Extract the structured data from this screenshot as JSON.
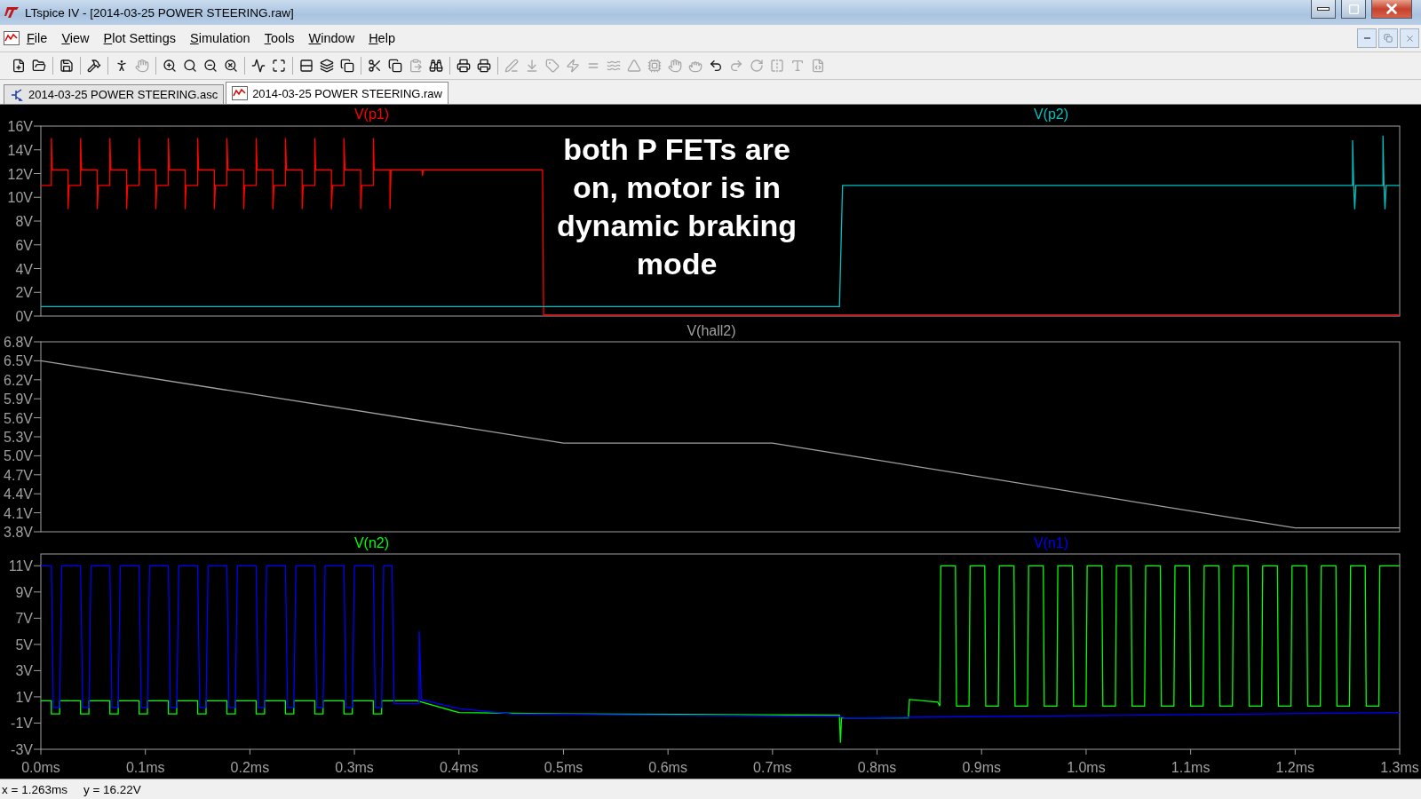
{
  "window": {
    "title": "LTspice IV - [2014-03-25 POWER STEERING.raw]"
  },
  "menu": [
    {
      "label": "File"
    },
    {
      "label": "View"
    },
    {
      "label": "Plot Settings"
    },
    {
      "label": "Simulation"
    },
    {
      "label": "Tools"
    },
    {
      "label": "Window"
    },
    {
      "label": "Help"
    }
  ],
  "toolbar": [
    {
      "kind": "button",
      "disabled": false
    },
    {
      "kind": "button",
      "disabled": false
    },
    {
      "kind": "separator"
    },
    {
      "kind": "button",
      "disabled": false
    },
    {
      "kind": "separator"
    },
    {
      "kind": "button",
      "disabled": false
    },
    {
      "kind": "separator"
    },
    {
      "kind": "button",
      "disabled": false
    },
    {
      "kind": "button",
      "disabled": true
    },
    {
      "kind": "separator"
    },
    {
      "kind": "button",
      "disabled": false
    },
    {
      "kind": "button",
      "disabled": false
    },
    {
      "kind": "button",
      "disabled": false
    },
    {
      "kind": "button",
      "disabled": false
    },
    {
      "kind": "separator"
    },
    {
      "kind": "button",
      "disabled": false
    },
    {
      "kind": "button",
      "disabled": false
    },
    {
      "kind": "separator"
    },
    {
      "kind": "button",
      "disabled": false
    },
    {
      "kind": "button",
      "disabled": false
    },
    {
      "kind": "button",
      "disabled": false
    },
    {
      "kind": "separator"
    },
    {
      "kind": "button",
      "disabled": false
    },
    {
      "kind": "button",
      "disabled": false
    },
    {
      "kind": "button",
      "disabled": true
    },
    {
      "kind": "button",
      "disabled": false
    },
    {
      "kind": "separator"
    },
    {
      "kind": "button",
      "disabled": false
    },
    {
      "kind": "button",
      "disabled": false
    },
    {
      "kind": "separator"
    },
    {
      "kind": "button",
      "disabled": true
    },
    {
      "kind": "button",
      "disabled": true
    },
    {
      "kind": "button",
      "disabled": true
    },
    {
      "kind": "button",
      "disabled": true
    },
    {
      "kind": "button",
      "disabled": true
    },
    {
      "kind": "button",
      "disabled": true
    },
    {
      "kind": "button",
      "disabled": true
    },
    {
      "kind": "button",
      "disabled": true
    },
    {
      "kind": "button",
      "disabled": true
    },
    {
      "kind": "button",
      "disabled": true
    },
    {
      "kind": "button",
      "disabled": false
    },
    {
      "kind": "button",
      "disabled": true
    },
    {
      "kind": "button",
      "disabled": true
    },
    {
      "kind": "button",
      "disabled": true
    },
    {
      "kind": "button",
      "disabled": true
    },
    {
      "kind": "button",
      "disabled": true
    }
  ],
  "tabs": [
    {
      "label": "2014-03-25 POWER STEERING.asc",
      "kind": "schematic",
      "selected": false
    },
    {
      "label": "2014-03-25 POWER STEERING.raw",
      "kind": "waveform",
      "selected": true
    }
  ],
  "panes": [
    {
      "chart_data": {
        "type": "line",
        "xlim": [
          0,
          1.3
        ],
        "ylim": [
          0,
          16
        ],
        "yticks": [
          {
            "value": 16,
            "label": "16V"
          },
          {
            "value": 14,
            "label": "14V"
          },
          {
            "value": 12,
            "label": "12V"
          },
          {
            "value": 10,
            "label": "10V"
          },
          {
            "value": 8,
            "label": "8V"
          },
          {
            "value": 6,
            "label": "6V"
          },
          {
            "value": 4,
            "label": "4V"
          },
          {
            "value": 2,
            "label": "2V"
          },
          {
            "value": 0,
            "label": "0V"
          }
        ],
        "series": [
          {
            "name": "V(p1)",
            "color": "#ff0000",
            "x": [
              0,
              0.01,
              0.01,
              0.011,
              0.026,
              0.026,
              0.027,
              0.038,
              0.038,
              0.039,
              0.054,
              0.054,
              0.055,
              0.066,
              0.066,
              0.067,
              0.082,
              0.082,
              0.083,
              0.094,
              0.094,
              0.095,
              0.11,
              0.11,
              0.111,
              0.122,
              0.122,
              0.123,
              0.138,
              0.138,
              0.139,
              0.15,
              0.15,
              0.151,
              0.166,
              0.166,
              0.167,
              0.178,
              0.178,
              0.179,
              0.194,
              0.194,
              0.195,
              0.206,
              0.206,
              0.207,
              0.222,
              0.222,
              0.223,
              0.234,
              0.234,
              0.235,
              0.25,
              0.25,
              0.251,
              0.262,
              0.262,
              0.263,
              0.278,
              0.278,
              0.279,
              0.29,
              0.29,
              0.291,
              0.306,
              0.306,
              0.307,
              0.318,
              0.318,
              0.319,
              0.334,
              0.334,
              0.335,
              0.365,
              0.365,
              0.366,
              0.48,
              0.481,
              1.3
            ],
            "values": [
              11,
              11,
              15,
              12.3,
              12.3,
              9,
              11,
              11,
              15,
              12.3,
              12.3,
              9,
              11,
              11,
              15,
              12.3,
              12.3,
              9,
              11,
              11,
              15,
              12.3,
              12.3,
              9,
              11,
              11,
              15,
              12.3,
              12.3,
              9,
              11,
              11,
              15,
              12.3,
              12.3,
              9,
              11,
              11,
              15,
              12.3,
              12.3,
              9,
              11,
              11,
              15,
              12.3,
              12.3,
              9,
              11,
              11,
              15,
              12.3,
              12.3,
              9,
              11,
              11,
              15,
              12.3,
              12.3,
              9,
              11,
              11,
              15,
              12.3,
              12.3,
              9,
              11,
              11,
              15,
              12.3,
              12.3,
              9,
              12.3,
              12.3,
              11.8,
              12.3,
              12.3,
              0.1,
              0.1
            ]
          },
          {
            "name": "V(p2)",
            "color": "#00c0c0",
            "x": [
              0,
              0.764,
              0.767,
              1.255,
              1.255,
              1.256,
              1.257,
              1.258,
              1.284,
              1.284,
              1.285,
              1.286,
              1.287,
              1.3
            ],
            "values": [
              0.8,
              0.8,
              11,
              11,
              14.8,
              11,
              9,
              11,
              11,
              15.2,
              11,
              9,
              11,
              11
            ]
          }
        ],
        "annotations": [
          "both P FETs are",
          "on, motor is in",
          "dynamic braking",
          "mode"
        ]
      }
    },
    {
      "chart_data": {
        "type": "line",
        "xlim": [
          0,
          1.3
        ],
        "ylim": [
          3.8,
          6.8
        ],
        "yticks": [
          {
            "value": 6.8,
            "label": "6.8V"
          },
          {
            "value": 6.5,
            "label": "6.5V"
          },
          {
            "value": 6.2,
            "label": "6.2V"
          },
          {
            "value": 5.9,
            "label": "5.9V"
          },
          {
            "value": 5.6,
            "label": "5.6V"
          },
          {
            "value": 5.3,
            "label": "5.3V"
          },
          {
            "value": 5.0,
            "label": "5.0V"
          },
          {
            "value": 4.7,
            "label": "4.7V"
          },
          {
            "value": 4.4,
            "label": "4.4V"
          },
          {
            "value": 4.1,
            "label": "4.1V"
          },
          {
            "value": 3.8,
            "label": "3.8V"
          }
        ],
        "series": [
          {
            "name": "V(hall2)",
            "color": "#a0a0a0",
            "x": [
              0,
              0.5,
              0.7,
              1.2,
              1.3
            ],
            "values": [
              6.5,
              5.2,
              5.2,
              3.86,
              3.86
            ]
          }
        ]
      }
    },
    {
      "chart_data": {
        "type": "line",
        "xlim": [
          0,
          1.3
        ],
        "ylim": [
          -3,
          11.9
        ],
        "yticks": [
          {
            "value": 11,
            "label": "11V"
          },
          {
            "value": 9,
            "label": "9V"
          },
          {
            "value": 7,
            "label": "7V"
          },
          {
            "value": 5,
            "label": "5V"
          },
          {
            "value": 3,
            "label": "3V"
          },
          {
            "value": 1,
            "label": "1V"
          },
          {
            "value": -1,
            "label": "-1V"
          },
          {
            "value": -3,
            "label": "-3V"
          }
        ],
        "xticks": [
          {
            "value": 0,
            "label": "0.0ms"
          },
          {
            "value": 0.1,
            "label": "0.1ms"
          },
          {
            "value": 0.2,
            "label": "0.2ms"
          },
          {
            "value": 0.3,
            "label": "0.3ms"
          },
          {
            "value": 0.4,
            "label": "0.4ms"
          },
          {
            "value": 0.5,
            "label": "0.5ms"
          },
          {
            "value": 0.6,
            "label": "0.6ms"
          },
          {
            "value": 0.7,
            "label": "0.7ms"
          },
          {
            "value": 0.8,
            "label": "0.8ms"
          },
          {
            "value": 0.9,
            "label": "0.9ms"
          },
          {
            "value": 1.0,
            "label": "1.0ms"
          },
          {
            "value": 1.1,
            "label": "1.1ms"
          },
          {
            "value": 1.2,
            "label": "1.2ms"
          },
          {
            "value": 1.3,
            "label": "1.3ms"
          }
        ],
        "series": [
          {
            "name": "V(n2)",
            "color": "#00ff00",
            "x": [
              0,
              0.01,
              0.01,
              0.018,
              0.018,
              0.038,
              0.038,
              0.046,
              0.046,
              0.066,
              0.066,
              0.074,
              0.074,
              0.094,
              0.094,
              0.102,
              0.102,
              0.122,
              0.122,
              0.13,
              0.13,
              0.15,
              0.15,
              0.158,
              0.158,
              0.178,
              0.178,
              0.186,
              0.186,
              0.206,
              0.206,
              0.214,
              0.214,
              0.234,
              0.234,
              0.242,
              0.242,
              0.262,
              0.262,
              0.27,
              0.27,
              0.29,
              0.29,
              0.298,
              0.298,
              0.318,
              0.318,
              0.326,
              0.326,
              0.36,
              0.4,
              0.5,
              0.764,
              0.765,
              0.766,
              0.83,
              0.831,
              0.858,
              0.86,
              0.861,
              0.875,
              0.876,
              0.888,
              0.889,
              0.903,
              0.904,
              0.916,
              0.917,
              0.931,
              0.932,
              0.944,
              0.945,
              0.959,
              0.96,
              0.972,
              0.973,
              0.987,
              0.988,
              1.0,
              1.001,
              1.015,
              1.016,
              1.028,
              1.029,
              1.043,
              1.044,
              1.056,
              1.057,
              1.071,
              1.072,
              1.084,
              1.085,
              1.099,
              1.1,
              1.112,
              1.113,
              1.127,
              1.128,
              1.14,
              1.141,
              1.155,
              1.156,
              1.168,
              1.169,
              1.183,
              1.184,
              1.196,
              1.197,
              1.211,
              1.212,
              1.224,
              1.225,
              1.239,
              1.24,
              1.252,
              1.253,
              1.267,
              1.268,
              1.28,
              1.281,
              1.3
            ],
            "values": [
              0.7,
              0.7,
              -0.3,
              -0.3,
              0.7,
              0.7,
              -0.3,
              -0.3,
              0.7,
              0.7,
              -0.3,
              -0.3,
              0.7,
              0.7,
              -0.3,
              -0.3,
              0.7,
              0.7,
              -0.3,
              -0.3,
              0.7,
              0.7,
              -0.3,
              -0.3,
              0.7,
              0.7,
              -0.3,
              -0.3,
              0.7,
              0.7,
              -0.3,
              -0.3,
              0.7,
              0.7,
              -0.3,
              -0.3,
              0.7,
              0.7,
              -0.3,
              -0.3,
              0.7,
              0.7,
              -0.3,
              -0.3,
              0.7,
              0.7,
              -0.3,
              -0.3,
              0.7,
              0.7,
              -0.2,
              -0.3,
              -0.4,
              -2.5,
              -0.6,
              -0.6,
              0.8,
              0.6,
              0.3,
              11,
              11,
              0.3,
              0.3,
              11,
              11,
              0.3,
              0.3,
              11,
              11,
              0.3,
              0.3,
              11,
              11,
              0.3,
              0.3,
              11,
              11,
              0.3,
              0.3,
              11,
              11,
              0.3,
              0.3,
              11,
              11,
              0.3,
              0.3,
              11,
              11,
              0.3,
              0.3,
              11,
              11,
              0.3,
              0.3,
              11,
              11,
              0.3,
              0.3,
              11,
              11,
              0.3,
              0.3,
              11,
              11,
              0.3,
              0.3,
              11,
              11,
              0.3,
              0.3,
              11,
              11,
              0.3,
              0.3,
              11,
              11,
              0.3,
              0.3,
              11,
              11
            ]
          },
          {
            "name": "V(n1)",
            "color": "#0000ff",
            "x": [
              0,
              0.01,
              0.012,
              0.018,
              0.02,
              0.038,
              0.04,
              0.046,
              0.048,
              0.066,
              0.068,
              0.074,
              0.076,
              0.094,
              0.096,
              0.102,
              0.104,
              0.122,
              0.124,
              0.13,
              0.132,
              0.15,
              0.152,
              0.158,
              0.16,
              0.178,
              0.18,
              0.186,
              0.188,
              0.206,
              0.208,
              0.214,
              0.216,
              0.234,
              0.236,
              0.242,
              0.244,
              0.262,
              0.264,
              0.27,
              0.272,
              0.29,
              0.292,
              0.298,
              0.3,
              0.318,
              0.32,
              0.326,
              0.328,
              0.336,
              0.338,
              0.362,
              0.362,
              0.364,
              0.4,
              0.45,
              0.764,
              0.77,
              1.3
            ],
            "values": [
              11,
              11,
              0.2,
              0.2,
              11,
              11,
              0.2,
              0.2,
              11,
              11,
              0.2,
              0.2,
              11,
              11,
              0.2,
              0.2,
              11,
              11,
              0.2,
              0.2,
              11,
              11,
              0.2,
              0.2,
              11,
              11,
              0.2,
              0.2,
              11,
              11,
              0.2,
              0.2,
              11,
              11,
              0.2,
              0.2,
              11,
              11,
              0.2,
              0.2,
              11,
              11,
              0.2,
              0.2,
              11,
              11,
              0.2,
              0.2,
              11,
              11,
              0.5,
              0.5,
              6,
              0.8,
              0.1,
              -0.3,
              -0.5,
              -0.6,
              -0.2
            ]
          }
        ]
      }
    }
  ],
  "status_bar": {
    "x_reading": "x = 1.263ms",
    "y_reading": "y = 16.22V"
  }
}
